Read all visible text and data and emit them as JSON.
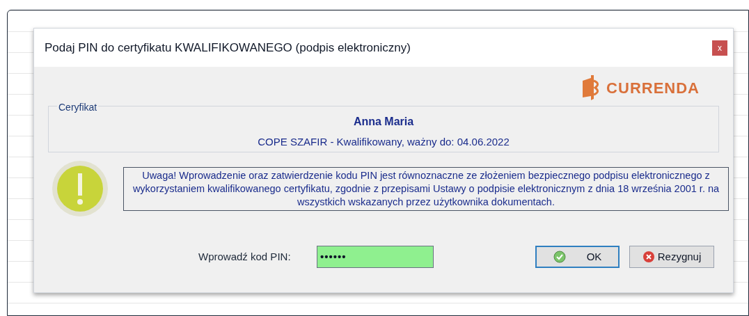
{
  "window": {
    "title": "Podaj PIN do certyfikatu KWALIFIKOWANEGO (podpis elektroniczny)",
    "close": "x"
  },
  "logo": {
    "text": "CURRENDA"
  },
  "certificate": {
    "legend": "Ceryfikat",
    "holder": "Anna Maria",
    "details": "COPE SZAFIR - Kwalifikowany, ważny do: 04.06.2022"
  },
  "warning": {
    "text": "Uwaga! Wprowadzenie oraz zatwierdzenie kodu PIN jest równoznaczne ze złożeniem bezpiecznego podpisu elektronicznego z wykorzystaniem kwalifikowanego certyfikatu, zgodnie z przepisami Ustawy o podpisie elektronicznym z dnia 18 września 2001 r. na wszystkich wskazanych przez użytkownika dokumentach."
  },
  "pin_field": {
    "label": "Wprowadź kod PIN:",
    "value": "••••••"
  },
  "buttons": [
    {
      "kind": "ok",
      "label": "OK"
    },
    {
      "kind": "cancel",
      "label": "Rezygnuj"
    }
  ]
}
